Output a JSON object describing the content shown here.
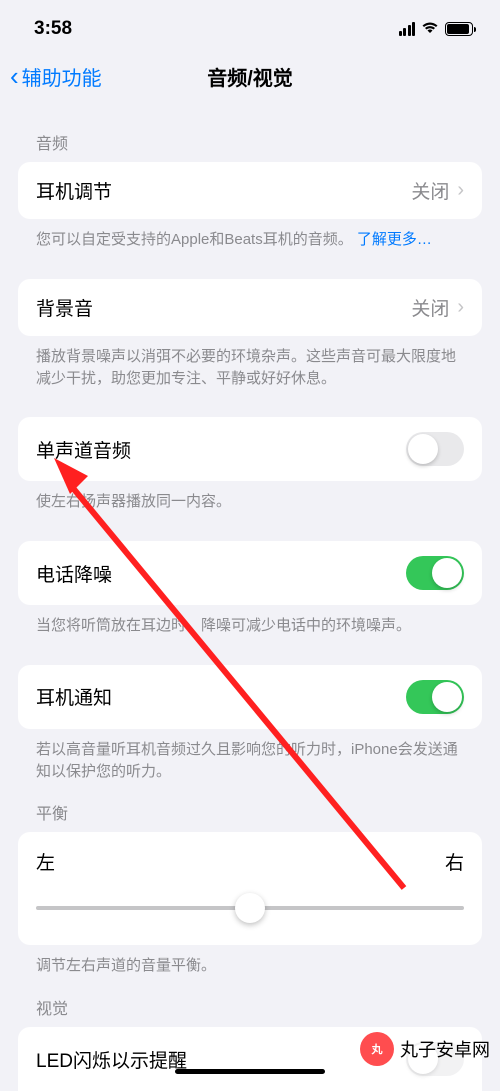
{
  "status": {
    "time": "3:58"
  },
  "nav": {
    "back": "辅助功能",
    "title": "音频/视觉"
  },
  "sections": {
    "audio_header": "音频",
    "headphone_adjust": {
      "label": "耳机调节",
      "value": "关闭"
    },
    "headphone_adjust_footer": "您可以自定受支持的Apple和Beats耳机的音频。",
    "learn_more": "了解更多…",
    "background_sound": {
      "label": "背景音",
      "value": "关闭"
    },
    "background_sound_footer": "播放背景噪声以消弭不必要的环境杂声。这些声音可最大限度地减少干扰，助您更加专注、平静或好好休息。",
    "mono_audio": {
      "label": "单声道音频"
    },
    "mono_audio_footer": "使左右扬声器播放同一内容。",
    "phone_noise": {
      "label": "电话降噪"
    },
    "phone_noise_footer": "当您将听筒放在耳边时，降噪可减少电话中的环境噪声。",
    "headphone_notify": {
      "label": "耳机通知"
    },
    "headphone_notify_footer": "若以高音量听耳机音频过久且影响您的听力时，iPhone会发送通知以保护您的听力。",
    "balance_header": "平衡",
    "balance": {
      "left": "左",
      "right": "右"
    },
    "balance_footer": "调节左右声道的音量平衡。",
    "visual_header": "视觉",
    "led_flash": {
      "label": "LED闪烁以示提醒"
    }
  },
  "watermark": "丸子安卓网"
}
